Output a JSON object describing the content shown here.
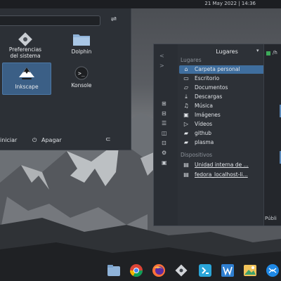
{
  "top_panel": {
    "datetime": "21 May 2022 | 14:36"
  },
  "launcher": {
    "apps": [
      {
        "name": "Preferencias del sistema",
        "line1": "Preferencias",
        "line2": "del sistema",
        "icon": "settings-icon"
      },
      {
        "name": "Dolphin",
        "icon": "folder-icon"
      },
      {
        "name": "Inkscape",
        "icon": "inkscape-icon",
        "selected": true
      },
      {
        "name": "Konsole",
        "icon": "terminal-icon"
      }
    ],
    "footer": {
      "restart_label": "iniciar",
      "shutdown_label": "Apagar"
    }
  },
  "dolphin": {
    "title": "Lugares",
    "places_section": "Lugares",
    "places": [
      {
        "label": "Carpeta personal",
        "icon": "home-icon",
        "active": true
      },
      {
        "label": "Escritorio",
        "icon": "desktop-icon"
      },
      {
        "label": "Documentos",
        "icon": "documents-folder-icon"
      },
      {
        "label": "Descargas",
        "icon": "download-icon"
      },
      {
        "label": "Música",
        "icon": "music-icon"
      },
      {
        "label": "Imágenes",
        "icon": "image-icon"
      },
      {
        "label": "Vídeos",
        "icon": "video-icon"
      },
      {
        "label": "github",
        "icon": "folder-icon"
      },
      {
        "label": "plasma",
        "icon": "folder-icon"
      }
    ],
    "devices_section": "Dispositivos",
    "devices": [
      {
        "label": "Unidad interna de ...",
        "icon": "drive-icon"
      },
      {
        "label": "fedora_localhost-li...",
        "icon": "drive-icon"
      }
    ],
    "right_pane_text": "/h",
    "public_label": "Públi"
  },
  "dock": {
    "apps": [
      "folder-icon",
      "chromium-icon",
      "firefox-icon",
      "inkscape-icon",
      "vscode-icon",
      "writer-icon",
      "image-viewer-icon",
      "kdeconnect-icon"
    ]
  }
}
